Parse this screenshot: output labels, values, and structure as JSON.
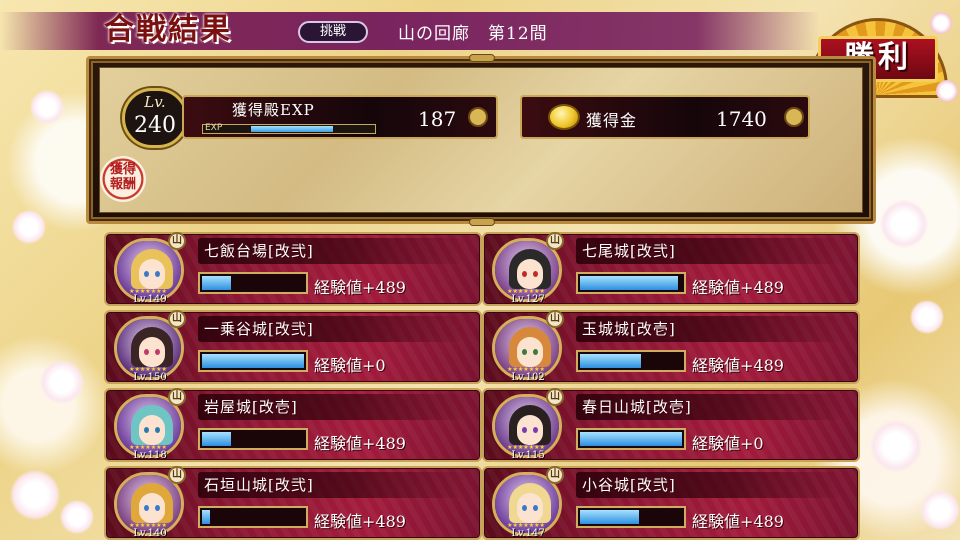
{
  "header": {
    "result_title": "合戦結果",
    "challenge_badge": "挑戦",
    "stage_name": "山の回廊　第12間",
    "victory_label": "勝利"
  },
  "rewards": {
    "level_label": "Lv.",
    "level": "240",
    "exp_label": "獲得殿EXP",
    "exp_bar_tag": "EXP",
    "exp_value": "187",
    "exp_progress": 0.68,
    "gold_label": "獲得金",
    "gold_value": "1740",
    "seal_text": "獲得報酬"
  },
  "cards": [
    {
      "name": "七飯台場[改弐]",
      "level": "Lv.149",
      "xp": "経験値+489",
      "fill": 0.28,
      "type": "山",
      "hair": "#e9c25a",
      "bg": "#6b3a9a",
      "eye": "#3a78c8"
    },
    {
      "name": "七尾城[改弐]",
      "level": "Lv.127",
      "xp": "経験値+489",
      "fill": 0.96,
      "type": "山",
      "hair": "#2b2a2a",
      "bg": "#7a3f8a",
      "eye": "#c02a2a"
    },
    {
      "name": "一乗谷城[改弐]",
      "level": "Lv.150",
      "xp": "経験値+0",
      "fill": 1.0,
      "type": "山",
      "hair": "#3b2424",
      "bg": "#5a2f7a",
      "eye": "#c03a68"
    },
    {
      "name": "玉城城[改壱]",
      "level": "Lv.102",
      "xp": "経験値+489",
      "fill": 0.6,
      "type": "山",
      "hair": "#d8883a",
      "bg": "#7a3f80",
      "eye": "#3b7a3b"
    },
    {
      "name": "岩屋城[改壱]",
      "level": "Lv.118",
      "xp": "経験値+489",
      "fill": 0.28,
      "type": "山",
      "hair": "#6fc4c4",
      "bg": "#6b3a9a",
      "eye": "#2a7ab0"
    },
    {
      "name": "春日山城[改壱]",
      "level": "Lv.115",
      "xp": "経験値+0",
      "fill": 1.0,
      "type": "山",
      "hair": "#2b2020",
      "bg": "#6b3a8a",
      "eye": "#7a3ab0"
    },
    {
      "name": "石垣山城[改弐]",
      "level": "Lv.140",
      "xp": "経験値+489",
      "fill": 0.08,
      "type": "山",
      "hair": "#e0a83a",
      "bg": "#7a3f80",
      "eye": "#3a78c8"
    },
    {
      "name": "小谷城[改弐]",
      "level": "Lv.147",
      "xp": "経験値+489",
      "fill": 0.58,
      "type": "山",
      "hair": "#f0d890",
      "bg": "#6b3a9a",
      "eye": "#3a78c8"
    }
  ]
}
